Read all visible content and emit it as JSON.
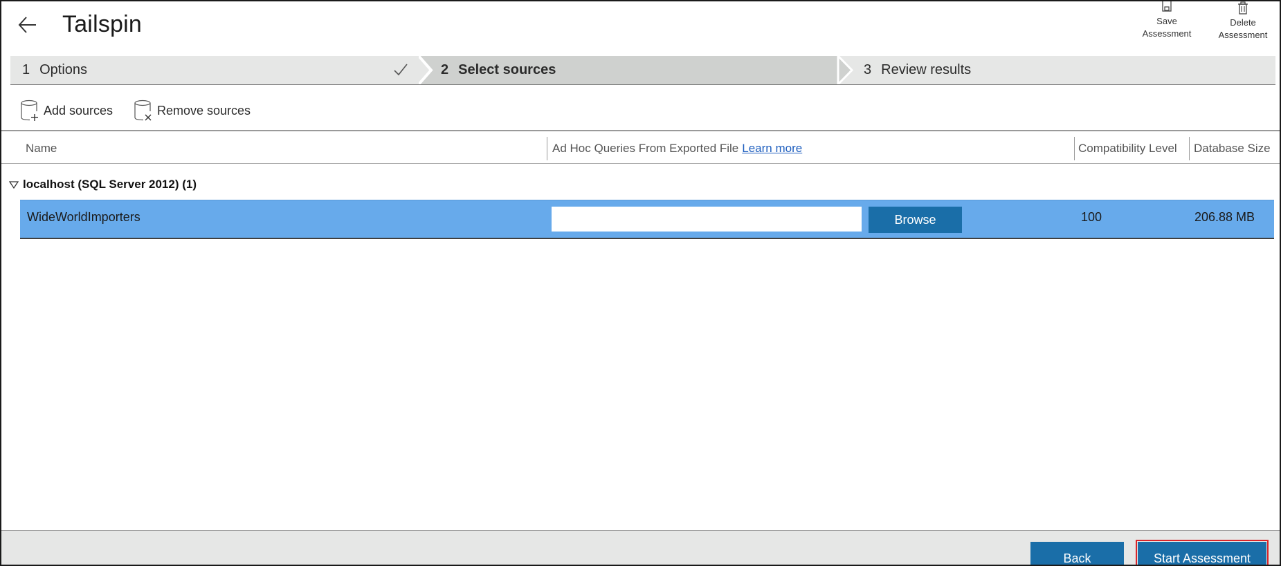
{
  "header": {
    "title": "Tailspin",
    "actions": [
      {
        "label_line1": "Save",
        "label_line2": "Assessment",
        "icon": "save-icon"
      },
      {
        "label_line1": "Delete",
        "label_line2": "Assessment",
        "icon": "trash-icon"
      }
    ]
  },
  "stepper": {
    "steps": [
      {
        "number": "1",
        "label": "Options",
        "state": "completed"
      },
      {
        "number": "2",
        "label": "Select sources",
        "state": "active"
      },
      {
        "number": "3",
        "label": "Review results",
        "state": "pending"
      }
    ]
  },
  "toolbar": {
    "add_label": "Add sources",
    "remove_label": "Remove sources"
  },
  "table": {
    "columns": {
      "name": "Name",
      "adhoc": "Ad Hoc Queries From Exported File",
      "adhoc_link": "Learn more",
      "compat": "Compatibility Level",
      "size": "Database Size"
    },
    "group": {
      "label": "localhost (SQL Server 2012) (1)",
      "expanded": true
    },
    "rows": [
      {
        "name": "WideWorldImporters",
        "file_value": "",
        "browse_label": "Browse",
        "compat": "100",
        "size": "206.88 MB",
        "selected": true
      }
    ]
  },
  "footer": {
    "back_label": "Back",
    "start_label": "Start Assessment"
  },
  "colors": {
    "accent": "#1a6ea8",
    "selection": "#67aaeb",
    "stepper_bg": "#e6e7e6",
    "active_step_bg": "#cfd1cf",
    "highlight_border": "#d9252a",
    "link": "#1f5fbf"
  }
}
